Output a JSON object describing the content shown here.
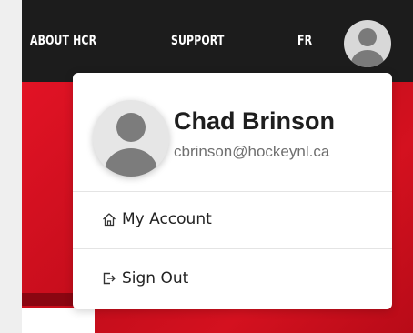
{
  "nav": {
    "about": "ABOUT HCR",
    "support": "SUPPORT",
    "language": "FR",
    "avatar_icon": "user-avatar-icon"
  },
  "profile": {
    "name": "Chad Brinson",
    "email": "cbrinson@hockeynl.ca",
    "avatar_icon": "user-avatar-icon"
  },
  "menu": {
    "items": [
      {
        "label": "My Account",
        "icon": "home-icon"
      },
      {
        "label": "Sign Out",
        "icon": "sign-out-icon"
      }
    ]
  },
  "colors": {
    "topbar": "#1c1c1c",
    "hero_red": "#d0101e",
    "text_dark": "#1e1e1e",
    "text_muted": "#6f6f6f"
  }
}
